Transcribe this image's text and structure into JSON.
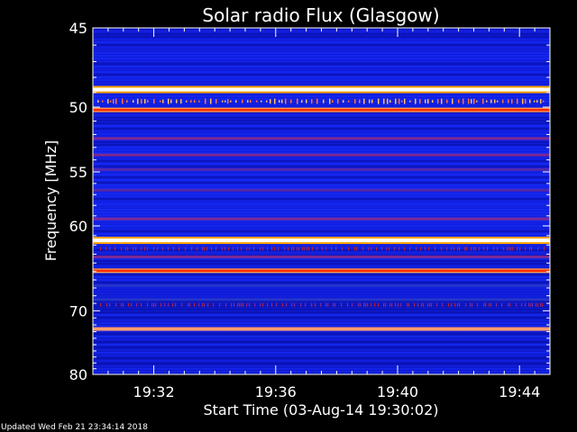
{
  "chart_data": {
    "type": "heatmap",
    "title": "Solar radio Flux (Glasgow)",
    "xlabel": "Start Time (03-Aug-14 19:30:02)",
    "ylabel": "Frequency [MHz]",
    "x_ticks": [
      "19:32",
      "19:36",
      "19:40",
      "19:44"
    ],
    "x_tick_minutes": [
      2,
      6,
      10,
      14
    ],
    "x_range_minutes": [
      0,
      15
    ],
    "y_ticks": [
      45,
      50,
      55,
      60,
      70,
      80
    ],
    "y_range": [
      45,
      80
    ],
    "y_scale": "reciprocal",
    "colormap": [
      "#000080",
      "#0000ff",
      "#8b2a8a",
      "#ff0000",
      "#ffa500",
      "#ffffff"
    ],
    "background_color": "#0f1adc",
    "bands": [
      {
        "freq": 48.8,
        "level": 1.0
      },
      {
        "freq": 50.2,
        "level": 0.85
      },
      {
        "freq": 52.3,
        "level": 0.45
      },
      {
        "freq": 53.6,
        "level": 0.4
      },
      {
        "freq": 54.8,
        "level": 0.3
      },
      {
        "freq": 56.6,
        "level": 0.35
      },
      {
        "freq": 59.3,
        "level": 0.45
      },
      {
        "freq": 61.5,
        "level": 1.0
      },
      {
        "freq": 63.3,
        "level": 0.55
      },
      {
        "freq": 64.9,
        "level": 0.9
      },
      {
        "freq": 72.6,
        "level": 0.8
      },
      {
        "freq": 68.5,
        "level": 0.2
      },
      {
        "freq": 66.7,
        "level": 0.2
      }
    ]
  },
  "footer": {
    "updated": "Updated Wed Feb 21 23:34:14 2018"
  }
}
